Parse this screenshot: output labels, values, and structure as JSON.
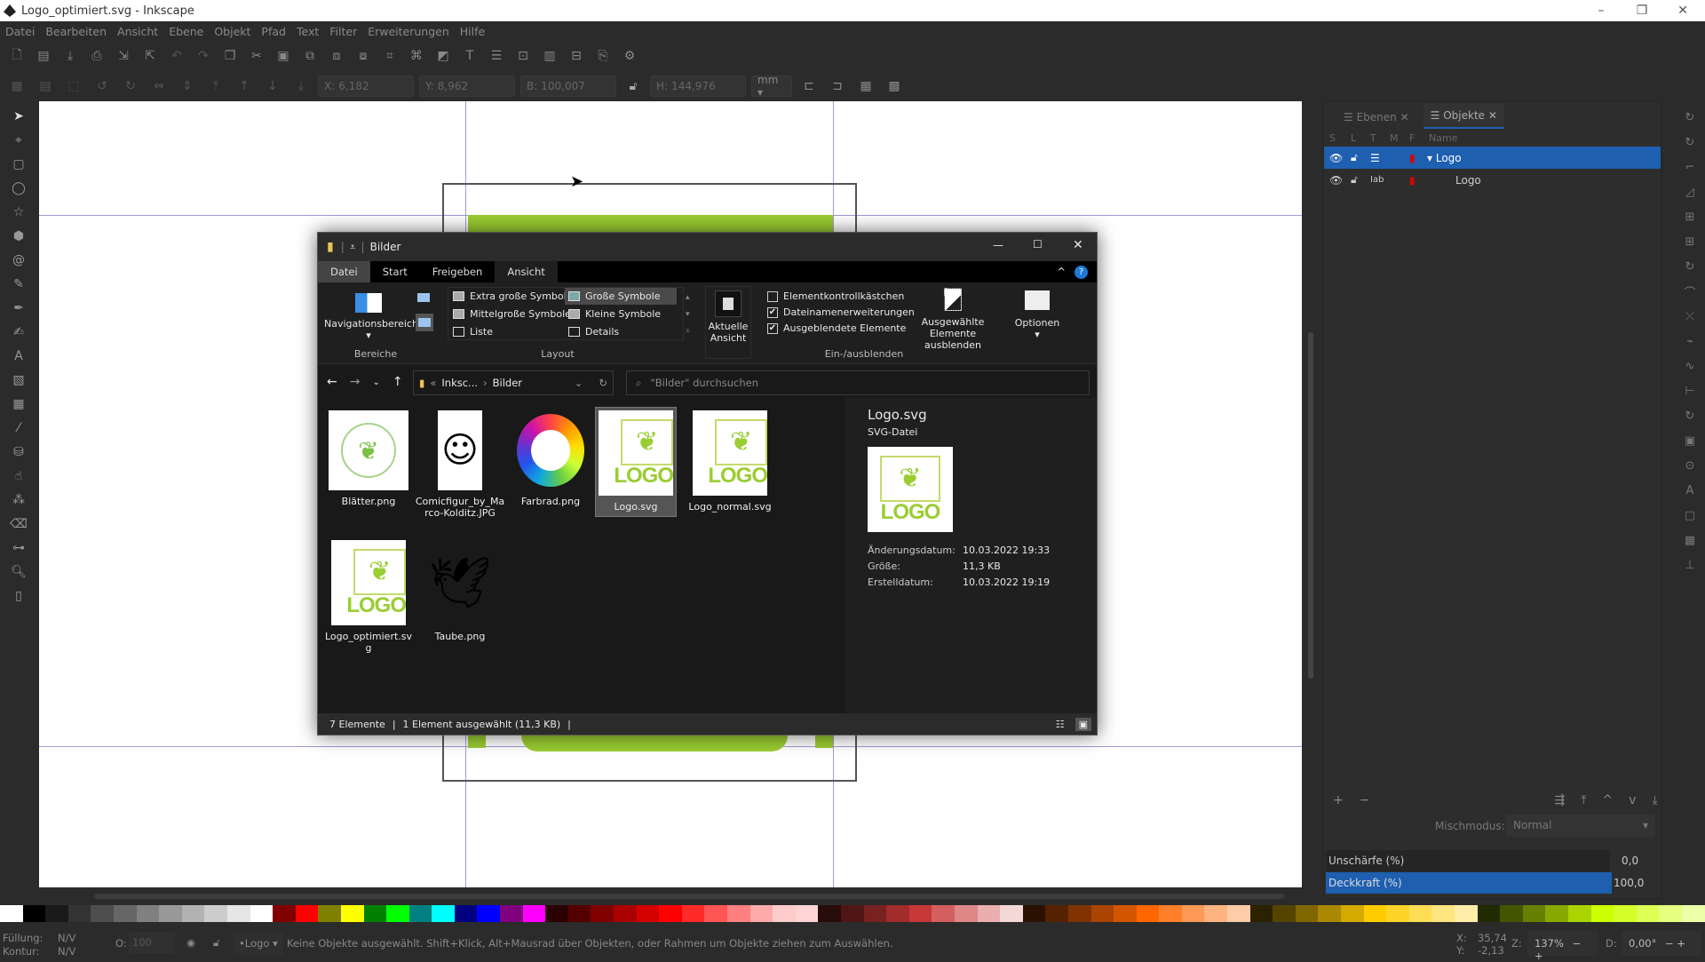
{
  "window": {
    "title": "Logo_optimiert.svg - Inkscape",
    "minimize": "–",
    "maximize": "❐",
    "close": "✕"
  },
  "menu": [
    "Datei",
    "Bearbeiten",
    "Ansicht",
    "Ebene",
    "Objekt",
    "Pfad",
    "Text",
    "Filter",
    "Erweiterungen",
    "Hilfe"
  ],
  "toolbar2": {
    "x_label": "X:",
    "x": "6,182",
    "y_label": "Y:",
    "y": "8,962",
    "w_label": "B:",
    "w": "100,007",
    "h_label": "H:",
    "h": "144,976",
    "unit": "mm ▾"
  },
  "panel": {
    "tabs": [
      {
        "label": "Ebenen",
        "active": false
      },
      {
        "label": "Objekte",
        "active": true
      }
    ],
    "columns": [
      "S",
      "L",
      "T",
      "M",
      "F",
      "Name"
    ],
    "rows": [
      {
        "name": "Logo",
        "expanded": true,
        "selected": true
      },
      {
        "name": "Logo",
        "selected": false
      }
    ],
    "blend_label": "Mischmodus:",
    "blend_value": "Normal",
    "blur_label": "Unschärfe (%)",
    "blur_value": "0,0",
    "opacity_label": "Deckkraft (%)",
    "opacity_value": "100,0",
    "accent": "#1e5fb0"
  },
  "status": {
    "fill_label": "Füllung:",
    "fill": "N/V",
    "stroke_label": "Kontur:",
    "stroke": "N/V",
    "opacity_label": "O:",
    "opacity": "100",
    "layer": "•Logo ▾",
    "message": "Keine Objekte ausgewählt. Shift+Klick, Alt+Mausrad über Objekten, oder Rahmen um Objekte ziehen zum Auswählen.",
    "cx_label": "X:",
    "cx": "35,74",
    "cy_label": "Y:",
    "cy": "-2,13",
    "zoom_label": "Z:",
    "zoom": "137%",
    "rot_label": "D:",
    "rotation": "0,00°"
  },
  "explorer": {
    "title": "Bilder",
    "tabs": [
      "Datei",
      "Start",
      "Freigeben",
      "Ansicht"
    ],
    "active_tab": "Ansicht",
    "ribbon": {
      "nav_pane": "Navigationsbereich",
      "group_panes": "Bereiche",
      "layout": [
        "Extra große Symbole",
        "Große Symbole",
        "Mittelgroße Symbole",
        "Kleine Symbole",
        "Liste",
        "Details"
      ],
      "layout_selected": "Große Symbole",
      "group_layout": "Layout",
      "current_view": "Aktuelle Ansicht",
      "checkboxes": [
        {
          "label": "Elementkontrollkästchen",
          "checked": false
        },
        {
          "label": "Dateinamenerweiterungen",
          "checked": true
        },
        {
          "label": "Ausgeblendete Elemente",
          "checked": true
        }
      ],
      "hide_selected": "Ausgewählte Elemente ausblenden",
      "options": "Optionen",
      "group_show": "Ein-/ausblenden"
    },
    "address": {
      "path_prefix": "«",
      "path1": "Inksc...",
      "sep": "›",
      "path2": "Bilder",
      "search_placeholder": "\"Bilder\" durchsuchen"
    },
    "files": [
      {
        "name": "Blätter.png",
        "kind": "leaves"
      },
      {
        "name": "Comicfigur_by_Marco-Kolditz.JPG",
        "kind": "comic"
      },
      {
        "name": "Farbrad.png",
        "kind": "wheel"
      },
      {
        "name": "Logo.svg",
        "kind": "logo",
        "selected": true
      },
      {
        "name": "Logo_normal.svg",
        "kind": "logo"
      },
      {
        "name": "Logo_optimiert.svg",
        "kind": "logo"
      },
      {
        "name": "Taube.png",
        "kind": "dove"
      }
    ],
    "preview": {
      "name": "Logo.svg",
      "type": "SVG-Datei",
      "logo_text": "LOGO",
      "modified_label": "Änderungsdatum:",
      "modified": "10.03.2022 19:33",
      "size_label": "Größe:",
      "size": "11,3 KB",
      "created_label": "Erstelldatum:",
      "created": "10.03.2022 19:19"
    },
    "statusbar": {
      "count": "7 Elemente",
      "selection": "1 Element ausgewählt (11,3 KB)"
    }
  },
  "canvas": {
    "logo_color": "#9acd32",
    "guide_color": "#a59ad6"
  }
}
